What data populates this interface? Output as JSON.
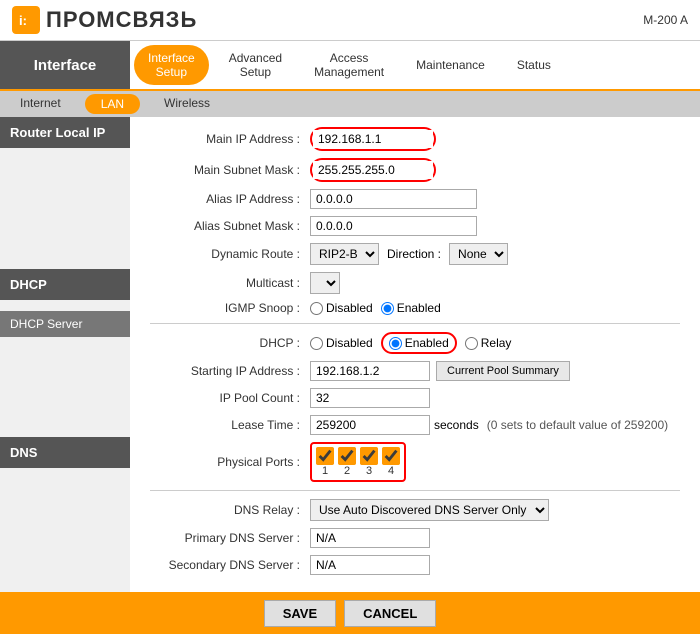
{
  "header": {
    "logo_letter": "i",
    "logo_name": "ПРОМСВЯЗЬ",
    "model": "M-200 A"
  },
  "main_nav": {
    "interface_label": "Interface",
    "items": [
      {
        "id": "interface-setup",
        "line1": "Interface",
        "line2": "Setup",
        "active": true
      },
      {
        "id": "advanced-setup",
        "line1": "Advanced",
        "line2": "Setup",
        "active": false
      },
      {
        "id": "access-management",
        "line1": "Access",
        "line2": "Management",
        "active": false
      },
      {
        "id": "maintenance",
        "line1": "Maintenance",
        "line2": "",
        "active": false
      },
      {
        "id": "status",
        "line1": "Status",
        "line2": "",
        "active": false
      }
    ]
  },
  "sub_nav": {
    "items": [
      {
        "id": "internet",
        "label": "Internet",
        "active": false
      },
      {
        "id": "lan",
        "label": "LAN",
        "active": true
      },
      {
        "id": "wireless",
        "label": "Wireless",
        "active": false
      }
    ]
  },
  "sidebar": {
    "sections": [
      {
        "id": "router-local-ip",
        "label": "Router Local IP"
      },
      {
        "id": "dhcp",
        "label": "DHCP"
      },
      {
        "id": "dhcp-server",
        "label": "DHCP Server"
      },
      {
        "id": "dns",
        "label": "DNS"
      }
    ]
  },
  "router_local_ip": {
    "main_ip_label": "Main IP Address :",
    "main_ip_value": "192.168.1.1",
    "main_subnet_label": "Main Subnet Mask :",
    "main_subnet_value": "255.255.255.0",
    "alias_ip_label": "Alias IP Address :",
    "alias_ip_value": "0.0.0.0",
    "alias_subnet_label": "Alias Subnet Mask :",
    "alias_subnet_value": "0.0.0.0",
    "dynamic_route_label": "Dynamic Route :",
    "dynamic_route_value": "RIP2-B",
    "direction_label": "Direction :",
    "direction_value": "None",
    "multicast_label": "Multicast :",
    "igmp_snoop_label": "IGMP Snoop :",
    "igmp_disabled": "Disabled",
    "igmp_enabled": "Enabled"
  },
  "dhcp": {
    "label": "DHCP :",
    "options": [
      "Disabled",
      "Enabled",
      "Relay"
    ],
    "selected": "Enabled"
  },
  "dhcp_server": {
    "starting_ip_label": "Starting IP Address :",
    "starting_ip_value": "192.168.1.2",
    "pool_summary_btn": "Current Pool Summary",
    "ip_pool_label": "IP Pool Count :",
    "ip_pool_value": "32",
    "lease_time_label": "Lease Time :",
    "lease_time_value": "259200",
    "lease_time_unit": "seconds",
    "lease_time_note": "(0 sets to default value of 259200)",
    "physical_ports_label": "Physical Ports :",
    "ports": [
      {
        "id": "1",
        "checked": true
      },
      {
        "id": "2",
        "checked": true
      },
      {
        "id": "3",
        "checked": true
      },
      {
        "id": "4",
        "checked": true
      }
    ]
  },
  "dns": {
    "relay_label": "DNS Relay :",
    "relay_options": [
      "Use Auto Discovered DNS Server Only"
    ],
    "relay_value": "Use Auto Discovered DNS Server Only",
    "primary_label": "Primary DNS Server :",
    "primary_value": "N/A",
    "secondary_label": "Secondary DNS Server :",
    "secondary_value": "N/A"
  },
  "buttons": {
    "save": "SAVE",
    "cancel": "CANCEL"
  }
}
